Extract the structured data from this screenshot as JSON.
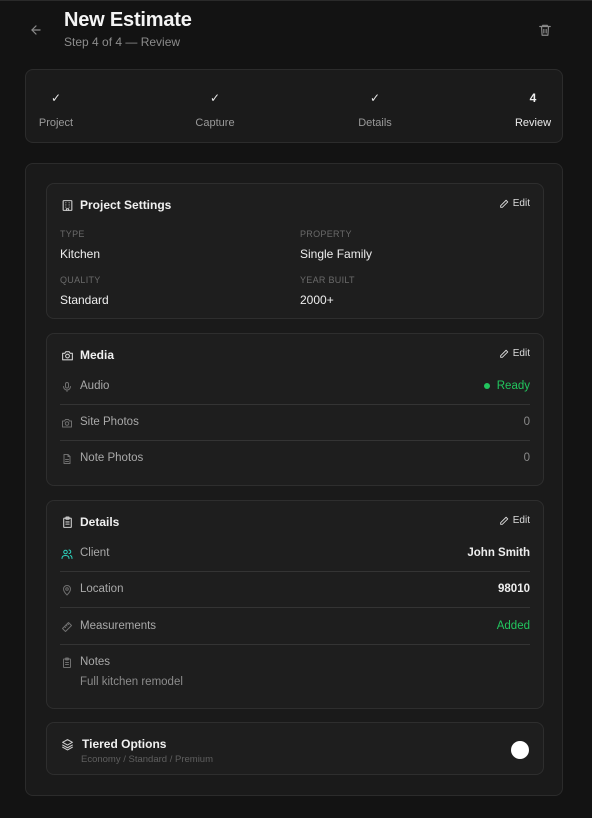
{
  "header": {
    "title": "New Estimate",
    "subtitle": "Step 4 of 4 — Review"
  },
  "steps": [
    {
      "label": "Project",
      "mark": "✓"
    },
    {
      "label": "Capture",
      "mark": "✓"
    },
    {
      "label": "Details",
      "mark": "✓"
    },
    {
      "label": "Review",
      "mark": "4"
    }
  ],
  "project_settings": {
    "title": "Project Settings",
    "edit_label": "Edit",
    "type_label": "TYPE",
    "type_value": "Kitchen",
    "property_label": "PROPERTY",
    "property_value": "Single Family",
    "quality_label": "QUALITY",
    "quality_value": "Standard",
    "year_label": "YEAR BUILT",
    "year_value": "2000+"
  },
  "media": {
    "title": "Media",
    "edit_label": "Edit",
    "rows": [
      {
        "label": "Audio",
        "value": "Ready"
      },
      {
        "label": "Site Photos",
        "value": "0"
      },
      {
        "label": "Note Photos",
        "value": "0"
      }
    ]
  },
  "details": {
    "title": "Details",
    "edit_label": "Edit",
    "rows": [
      {
        "label": "Client",
        "value": "John Smith"
      },
      {
        "label": "Location",
        "value": "98010"
      },
      {
        "label": "Measurements",
        "value": "Added"
      }
    ],
    "notes_label": "Notes",
    "notes_value": "Full kitchen remodel"
  },
  "tiered": {
    "title": "Tiered Options",
    "subtitle": "Economy / Standard / Premium"
  },
  "colors": {
    "accent_green": "#22c55e",
    "client_icon": "#2dd4bf"
  },
  "icons": {
    "back": "arrow-left-icon",
    "trash": "trash-icon",
    "project": "building-icon",
    "media": "camera-icon",
    "details": "clipboard-icon",
    "tiered": "layers-icon"
  }
}
